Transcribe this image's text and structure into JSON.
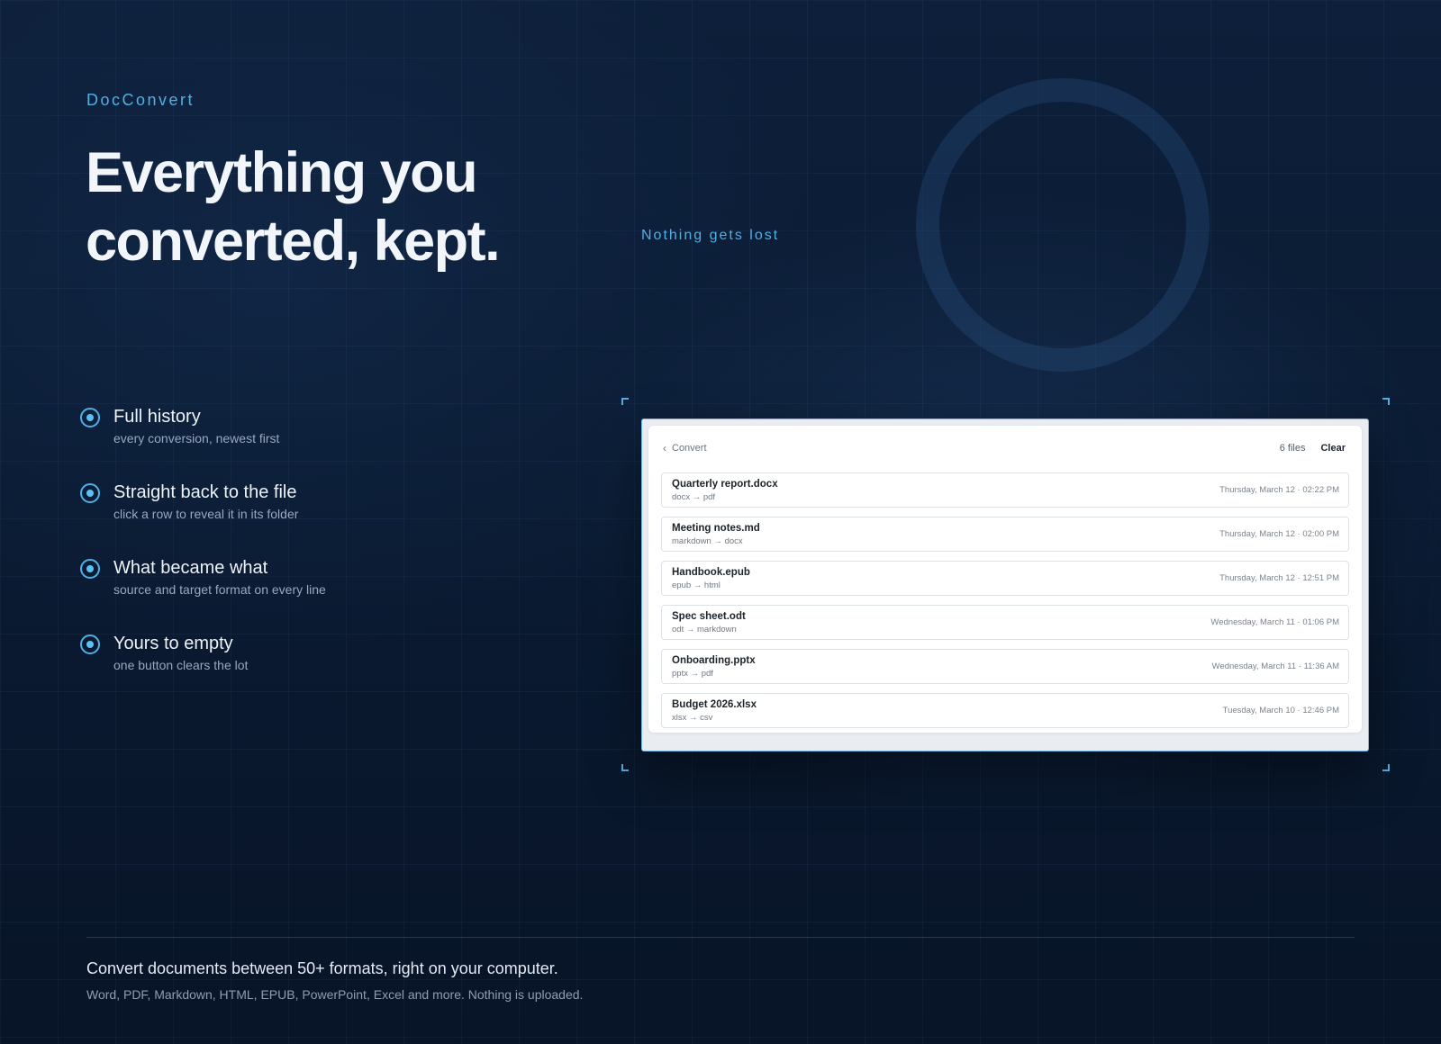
{
  "brand": "DocConvert",
  "hero": {
    "line1": "Everything you",
    "line2": "converted, kept."
  },
  "tagline": "Nothing gets lost",
  "features": [
    {
      "title": "Full history",
      "subtitle": "every conversion, newest first"
    },
    {
      "title": "Straight back to the file",
      "subtitle": "click a row to reveal it in its folder"
    },
    {
      "title": "What became what",
      "subtitle": "source and target format on every line"
    },
    {
      "title": "Yours to empty",
      "subtitle": "one button clears the lot"
    }
  ],
  "app": {
    "back_label": "Convert",
    "file_count": "6 files",
    "clear_label": "Clear",
    "rows": [
      {
        "name": "Quarterly report.docx",
        "conversion": "docx → pdf",
        "when": "Thursday, March 12 · 02:22 PM"
      },
      {
        "name": "Meeting notes.md",
        "conversion": "markdown → docx",
        "when": "Thursday, March 12 · 02:00 PM"
      },
      {
        "name": "Handbook.epub",
        "conversion": "epub → html",
        "when": "Thursday, March 12 · 12:51 PM"
      },
      {
        "name": "Spec sheet.odt",
        "conversion": "odt → markdown",
        "when": "Wednesday, March 11 · 01:06 PM"
      },
      {
        "name": "Onboarding.pptx",
        "conversion": "pptx → pdf",
        "when": "Wednesday, March 11 · 11:36 AM"
      },
      {
        "name": "Budget 2026.xlsx",
        "conversion": "xlsx → csv",
        "when": "Tuesday, March 10 · 12:46 PM"
      }
    ]
  },
  "footer": {
    "line1": "Convert documents between 50+ formats, right on your computer.",
    "line2": "Word, PDF, Markdown, HTML, EPUB, PowerPoint, Excel and more. Nothing is uploaded."
  },
  "colors": {
    "accent": "#4fb0e6",
    "background": "#0b1a30"
  },
  "icons": {
    "back": "chevron-left-icon",
    "bullet": "radio-dot-icon"
  }
}
